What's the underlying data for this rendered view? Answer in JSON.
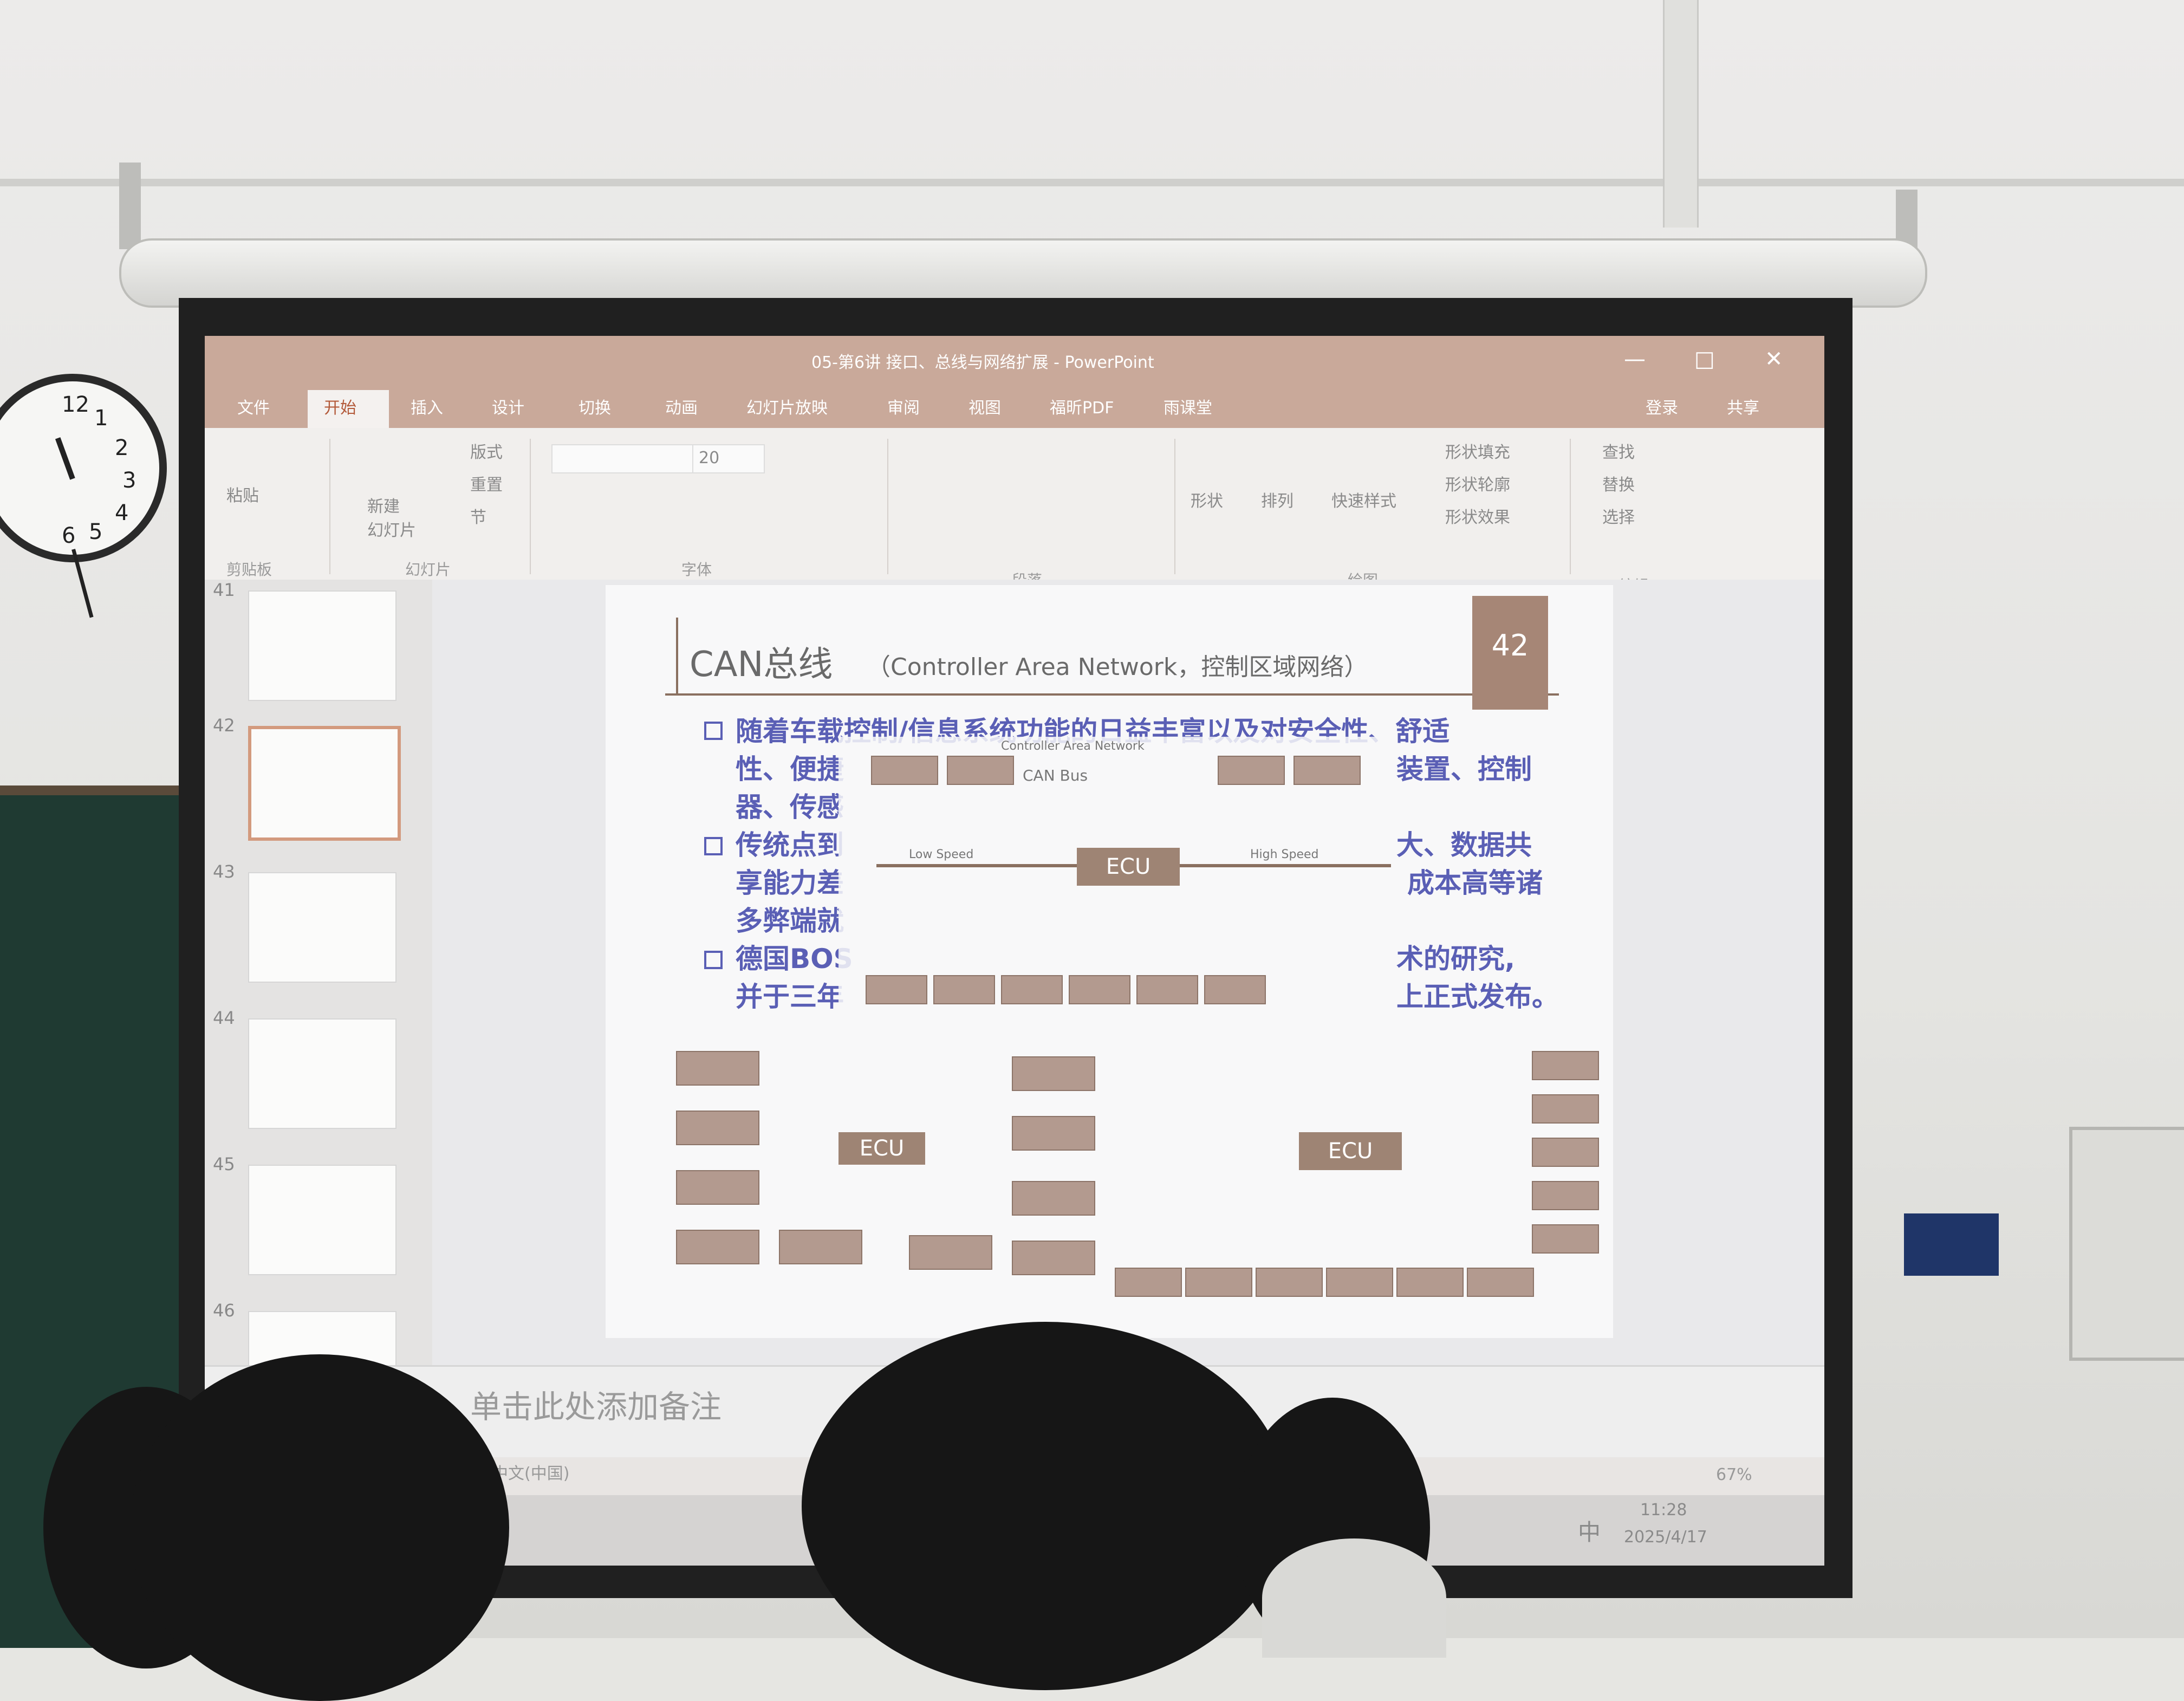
{
  "window": {
    "title": "05-第6讲 接口、总线与网络扩展 - PowerPoint",
    "buttons": [
      "—",
      "□",
      "✕"
    ]
  },
  "tabs": [
    "文件",
    "开始",
    "插入",
    "设计",
    "切换",
    "动画",
    "幻灯片放映",
    "审阅",
    "视图",
    "福昕PDF",
    "雨课堂"
  ],
  "tab_active": "开始",
  "account": {
    "login": "登录",
    "share": "共享"
  },
  "ribbon": {
    "paste": "粘贴",
    "new_slide": "新建\n幻灯片",
    "layout": "版式",
    "reset": "重置",
    "section": "节",
    "font_size": "20",
    "shape": "形状",
    "arrange": "排列",
    "quick_style": "快速样式",
    "shape_fill": "形状填充",
    "shape_outline": "形状轮廓",
    "shape_effect": "形状效果",
    "find": "查找",
    "replace": "替换",
    "select": "选择",
    "groups": [
      "剪贴板",
      "幻灯片",
      "字体",
      "段落",
      "绘图",
      "编辑"
    ]
  },
  "thumbnails": [
    "41",
    "42",
    "43",
    "44",
    "45",
    "46"
  ],
  "slide": {
    "number": "42",
    "title": "CAN总线",
    "title_sub": "（Controller Area Network，控制区域网络）",
    "bullets": [
      "随着车载控制/信息系统功能的日益丰富以及对安全性、舒适",
      "性、便捷",
      "器、传感",
      "传统点到",
      "享能力差",
      "多弊端就",
      "德国BOS",
      "并于三年"
    ],
    "bullet_right": [
      "装置、控制",
      "大、数据共",
      "成本高等诸",
      "术的研究,",
      "上正式发布。"
    ],
    "diagram_title": "Controller Area Network",
    "can_bus_label": "CAN Bus",
    "low_speed": "Low Speed",
    "high_speed": "High Speed",
    "ecu_label": "ECU"
  },
  "notes": {
    "placeholder": "单击此处添加备注"
  },
  "status": {
    "language": "中文(中国)",
    "zoom": "67%"
  },
  "taskbar": {
    "time": "11:28",
    "date": "2025/4/17",
    "ime": "中"
  },
  "clock": {
    "numbers": [
      "12",
      "1",
      "2",
      "3",
      "4",
      "5",
      "6"
    ]
  }
}
